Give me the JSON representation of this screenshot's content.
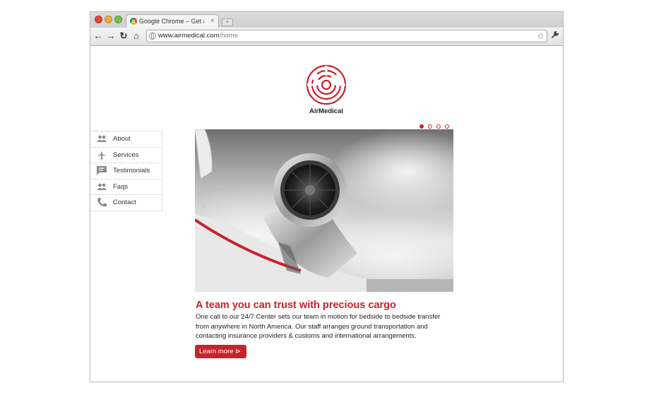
{
  "browser": {
    "tab_title": "Google Chrome – Get a fast",
    "tab_close": "×",
    "new_tab": "+",
    "url_host": "www.airmedical.com",
    "url_path": "/home",
    "star": "☆",
    "wrench": "🔧",
    "back": "←",
    "forward": "→",
    "reload": "↻",
    "home": "⌂"
  },
  "brand": {
    "name": "AirMedical",
    "accent_color": "#c8222b"
  },
  "slider": {
    "dots": 4,
    "active_index": 0,
    "prev_arrow": "‹",
    "next_arrow": "›"
  },
  "sidebar": {
    "items": [
      {
        "label": "About",
        "icon": "people-icon"
      },
      {
        "label": "Services",
        "icon": "airplane-icon"
      },
      {
        "label": "Testimonials",
        "icon": "chat-icon"
      },
      {
        "label": "Faqs",
        "icon": "people-icon"
      },
      {
        "label": "Contact",
        "icon": "phone-icon"
      }
    ]
  },
  "content": {
    "headline": "A team you can trust with precious cargo",
    "body": "One call to our 24/7 Center sets our team in motion for bedside to bedside transfer from anywhere in North America. Our staff arranges ground transportation and contacting insurance providers & customs and international arrangements.",
    "button_label": "Learn more",
    "button_icon": "⊳"
  }
}
